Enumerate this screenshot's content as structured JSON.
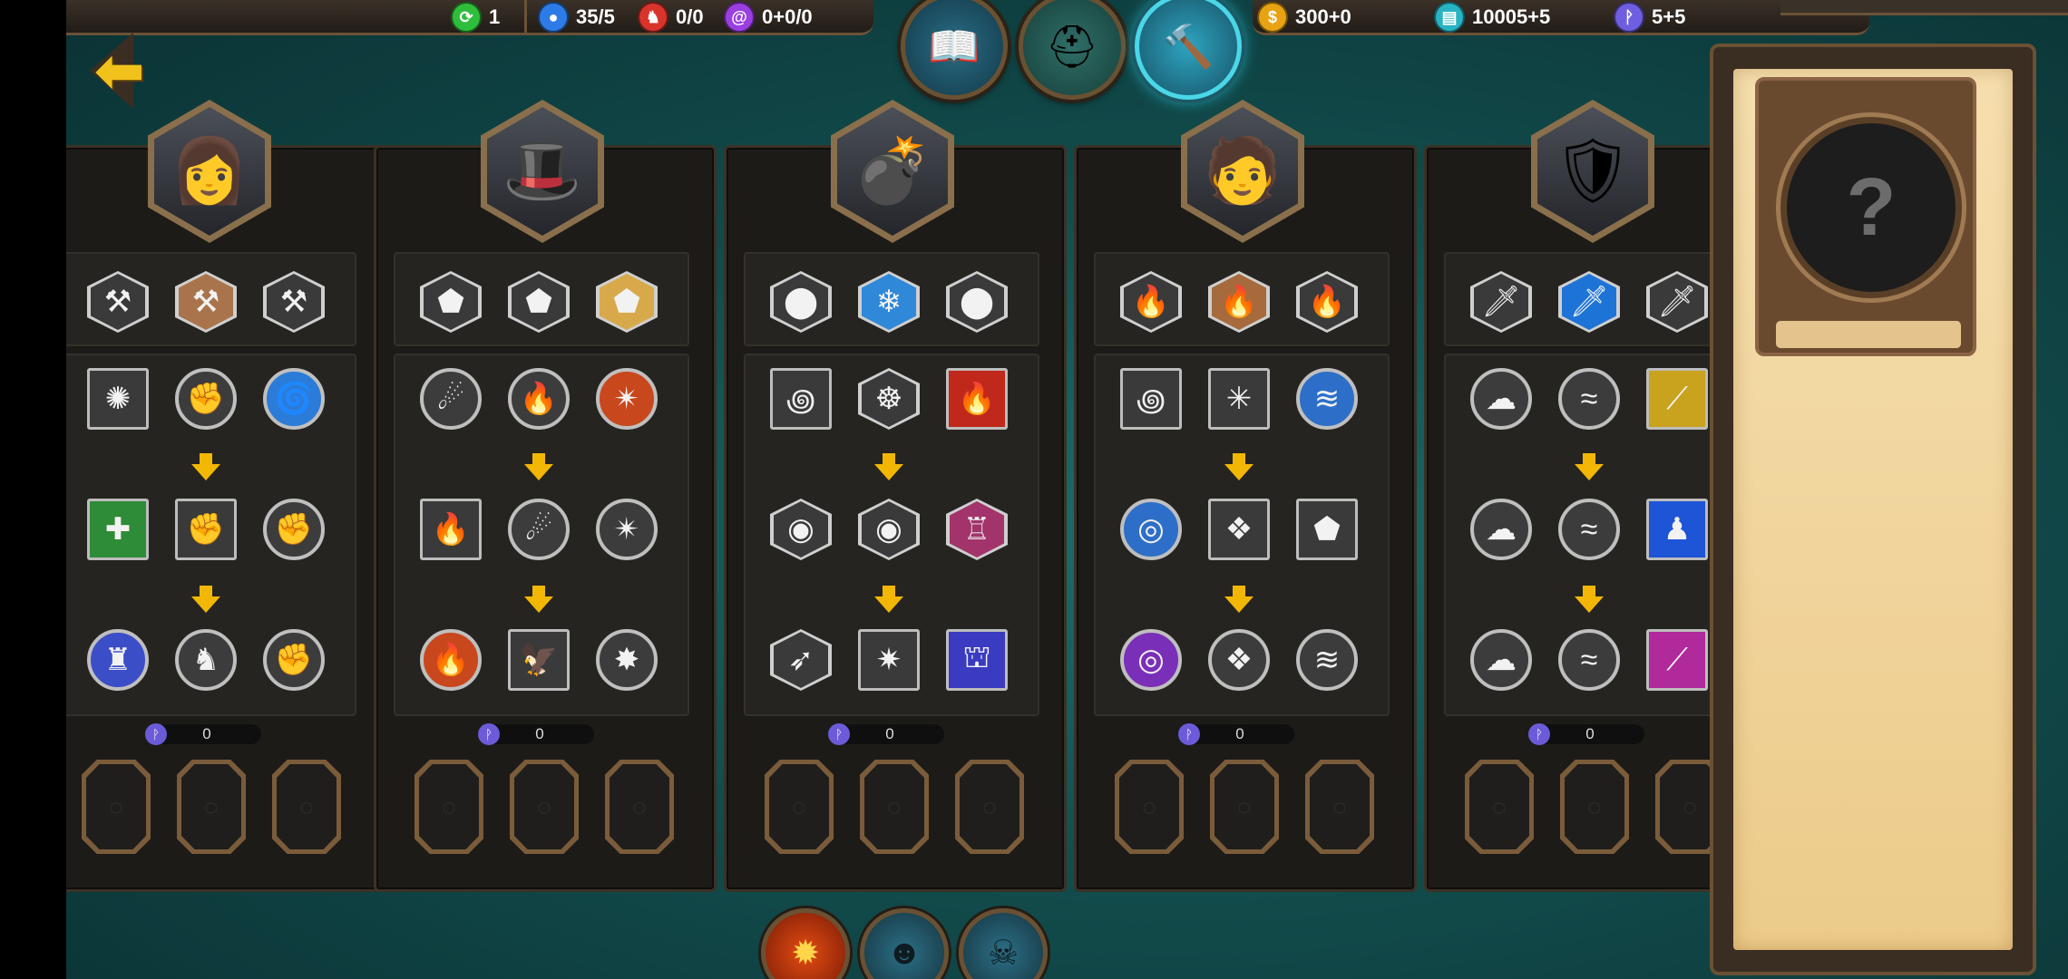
{
  "resources_left": [
    {
      "name": "green-resource",
      "value": "1",
      "icon": "recycle-icon",
      "color": "#2fbe3c"
    },
    {
      "name": "blue-resource",
      "value": "35/5",
      "icon": "person-icon",
      "color": "#2d7be6"
    },
    {
      "name": "red-resource",
      "value": "0/0",
      "icon": "horse-icon",
      "color": "#d9342b"
    },
    {
      "name": "purple-resource",
      "value": "0+0/0",
      "icon": "swirl-icon",
      "color": "#9a3fe0"
    }
  ],
  "resources_right": [
    {
      "name": "gold",
      "value": "300+0",
      "icon": "coin-icon",
      "color": "#e7a312"
    },
    {
      "name": "tomes",
      "value": "10005+5",
      "icon": "book-icon",
      "color": "#27b3c2"
    },
    {
      "name": "skill-points",
      "value": "5+5",
      "icon": "rune-icon",
      "color": "#6d5fe0"
    }
  ],
  "top_tabs": [
    {
      "name": "tome",
      "icon": "book-icon"
    },
    {
      "name": "helmet",
      "icon": "helmet-icon"
    },
    {
      "name": "forge",
      "icon": "hammer-icon",
      "active": true
    }
  ],
  "heroes": [
    {
      "name": "hero-1",
      "avatar": "👩",
      "points": "0"
    },
    {
      "name": "hero-2",
      "avatar": "🎩",
      "points": "0"
    },
    {
      "name": "hero-3",
      "avatar": "💣",
      "points": "0"
    },
    {
      "name": "hero-4",
      "avatar": "🧑",
      "points": "0"
    },
    {
      "name": "hero-5",
      "avatar": "🛡",
      "points": "0"
    }
  ],
  "detail": {
    "placeholder": "?"
  },
  "bottom_tabs": [
    {
      "name": "fire-emblem",
      "icon": "✹",
      "color": "#e24c12"
    },
    {
      "name": "mask",
      "icon": "☻",
      "color": "#2c6f86"
    },
    {
      "name": "demon",
      "icon": "☠",
      "color": "#2c6f86"
    }
  ]
}
